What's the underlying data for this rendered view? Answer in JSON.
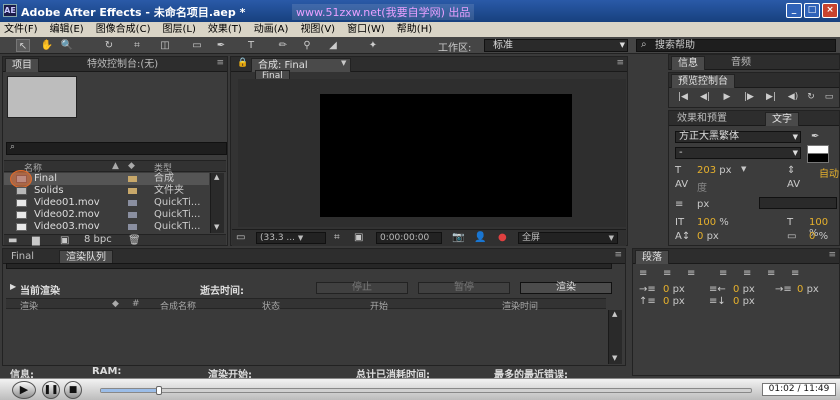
{
  "window": {
    "app_icon": "AE",
    "title": "Adobe After Effects - 未命名项目.aep *",
    "watermark": "www.51zxw.net(我要自学网) 出品",
    "buttons": [
      "_",
      "□",
      "×"
    ]
  },
  "menu": [
    "文件(F)",
    "编辑(E)",
    "图像合成(C)",
    "图层(L)",
    "效果(T)",
    "动画(A)",
    "视图(V)",
    "窗口(W)",
    "帮助(H)"
  ],
  "toolbar": {
    "workspace_label": "工作区:",
    "workspace_value": "标准",
    "search_placeholder": "搜索帮助"
  },
  "project_panel": {
    "tabs": [
      "项目",
      "特效控制台:(无)"
    ],
    "columns": [
      "名称",
      "类型"
    ],
    "items": [
      {
        "name": "Final",
        "type": "合成",
        "label_color": "#c8a86a",
        "icon": "composition-icon"
      },
      {
        "name": "Solids",
        "type": "文件夹",
        "label_color": "#c8a86a",
        "icon": "folder-icon"
      },
      {
        "name": "Video01.mov",
        "type": "QuickTi...",
        "label_color": "#8a8fa0",
        "icon": "film-icon"
      },
      {
        "name": "Video02.mov",
        "type": "QuickTi...",
        "label_color": "#8a8fa0",
        "icon": "film-icon"
      },
      {
        "name": "Video03.mov",
        "type": "QuickTi...",
        "label_color": "#8a8fa0",
        "icon": "film-icon"
      }
    ],
    "bpc": "8 bpc"
  },
  "composition_panel": {
    "tab": "合成: Final",
    "subtab": "Final",
    "zoom": "(33.3 ...",
    "timecode": "0:00:00:00",
    "resolution": "全屏"
  },
  "info_panel": {
    "tabs": [
      "信息",
      "音频"
    ]
  },
  "preview_panel": {
    "tab": "预览控制台",
    "controls": [
      "|◀",
      "◀|",
      "▶",
      "|▶",
      "▶|",
      "◀)",
      "↻",
      "▭"
    ]
  },
  "character_panel": {
    "tabs": [
      "效果和预置",
      "文字"
    ],
    "font": "方正大黑繁体",
    "style": "-",
    "size": "203",
    "size_unit": "px",
    "auto_label": "自动",
    "tracking_label": "度",
    "stroke_width": "px",
    "vertical_scale": "100",
    "horizontal_scale": "100",
    "percent": "%",
    "baseline": "0",
    "tsume": "0",
    "px": "px"
  },
  "paragraph_panel": {
    "tab": "段落",
    "indent_values": [
      "0",
      "0",
      "0",
      "0",
      "0"
    ],
    "unit": "px"
  },
  "render_queue": {
    "tabs": [
      "Final",
      "渲染队列"
    ],
    "current_render": "当前渲染",
    "elapsed": "逝去时间:",
    "stop": "停止",
    "pause": "暂停",
    "render": "渲染",
    "columns": [
      "渲染",
      "#",
      "合成名称",
      "状态",
      "开始",
      "渲染时间"
    ],
    "footer": {
      "info": "信息:",
      "ram": "RAM:",
      "render_start": "渲染开始:",
      "total_time": "总计已消耗时间:",
      "last_error": "最多的最近错误:"
    }
  },
  "player": {
    "time": "01:02 / 11:49",
    "progress": 0.089
  }
}
